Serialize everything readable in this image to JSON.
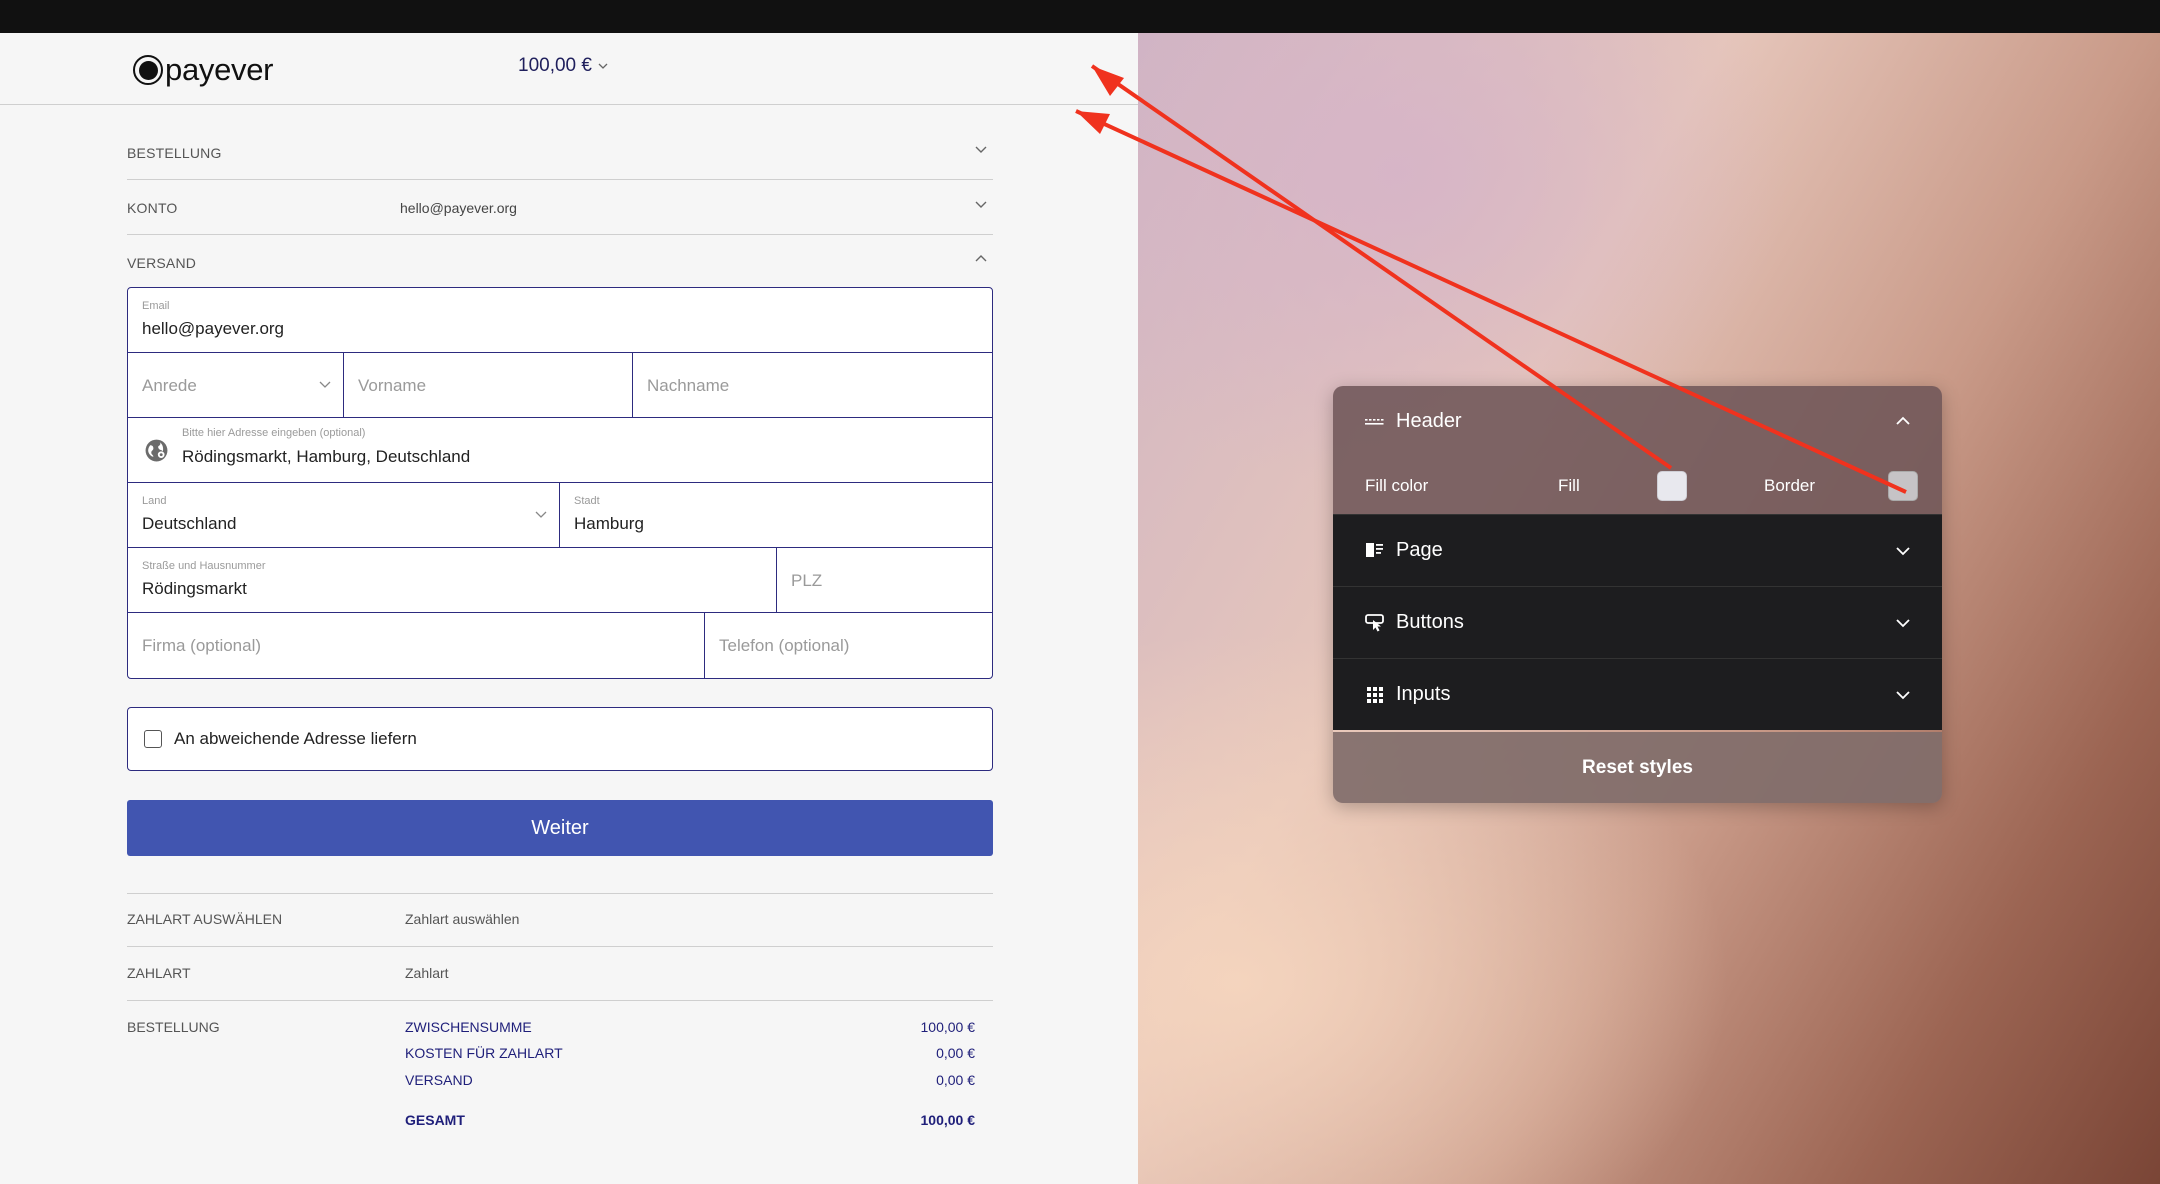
{
  "brand": {
    "logo_text": "payever"
  },
  "header": {
    "amount": "100,00 €"
  },
  "sections": {
    "bestellung": {
      "label": "BESTELLUNG"
    },
    "konto": {
      "label": "KONTO",
      "value": "hello@payever.org"
    },
    "versand": {
      "label": "VERSAND"
    }
  },
  "form": {
    "email": {
      "label": "Email",
      "value": "hello@payever.org"
    },
    "anrede": {
      "placeholder": "Anrede"
    },
    "vorname": {
      "placeholder": "Vorname"
    },
    "nachname": {
      "placeholder": "Nachname"
    },
    "address": {
      "label": "Bitte hier Adresse eingeben (optional)",
      "value": "Rödingsmarkt, Hamburg, Deutschland"
    },
    "land": {
      "label": "Land",
      "value": "Deutschland"
    },
    "stadt": {
      "label": "Stadt",
      "value": "Hamburg"
    },
    "strasse": {
      "label": "Straße und Hausnummer",
      "value": "Rödingsmarkt"
    },
    "plz": {
      "placeholder": "PLZ"
    },
    "firma": {
      "placeholder": "Firma (optional)"
    },
    "telefon": {
      "placeholder": "Telefon (optional)"
    }
  },
  "checkbox": {
    "label": "An abweichende Adresse liefern",
    "checked": false
  },
  "submit": {
    "label": "Weiter"
  },
  "payment": {
    "select": {
      "label": "ZAHLART AUSWÄHLEN",
      "value": "Zahlart auswählen"
    },
    "method": {
      "label": "ZAHLART",
      "value": "Zahlart"
    }
  },
  "summary": {
    "label": "BESTELLUNG",
    "rows": [
      {
        "label": "ZWISCHENSUMME",
        "value": "100,00 €"
      },
      {
        "label": "KOSTEN FÜR ZAHLART",
        "value": "0,00 €"
      },
      {
        "label": "VERSAND",
        "value": "0,00 €"
      }
    ],
    "total": {
      "label": "GESAMT",
      "value": "100,00 €"
    }
  },
  "panel": {
    "header": {
      "title": "Header",
      "fill_color_label": "Fill color",
      "fill_label": "Fill",
      "border_label": "Border",
      "fill_swatch": "#e8e8ee",
      "border_swatch": "#c6c3c6"
    },
    "items": [
      {
        "label": "Page",
        "icon": "page-icon"
      },
      {
        "label": "Buttons",
        "icon": "buttons-icon"
      },
      {
        "label": "Inputs",
        "icon": "inputs-icon"
      }
    ],
    "reset_label": "Reset styles"
  },
  "colors": {
    "accent": "#4155b0",
    "form_border": "#2d2b7f",
    "annotation_arrow": "#f0321e",
    "panel_dark": "#1d1d1f"
  }
}
